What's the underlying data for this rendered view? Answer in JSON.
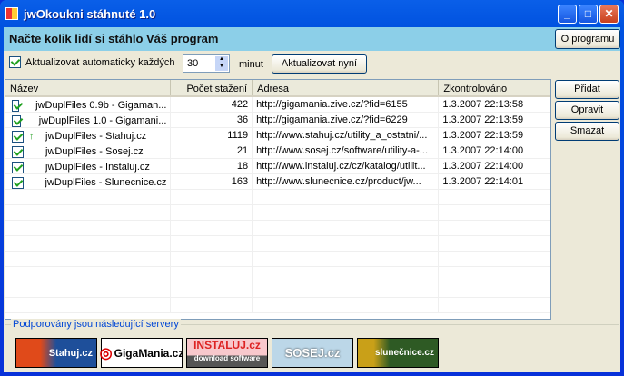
{
  "window": {
    "title": "jwOkoukni stáhnuté 1.0"
  },
  "header": {
    "text": "Načte kolik lidí si stáhlo Váš program",
    "about_button": "O programu"
  },
  "toolbar": {
    "auto_update_label": "Aktualizovat automaticky každých",
    "interval": "30",
    "unit": "minut",
    "update_now": "Aktualizovat nyní",
    "auto_update_checked": true
  },
  "table": {
    "columns": [
      "Název",
      "Počet stažení",
      "Adresa",
      "Zkontrolováno"
    ],
    "rows": [
      {
        "name": "jwDuplFiles 0.9b - Gigaman...",
        "count": "422",
        "url": "http://gigamania.zive.cz/?fid=6155",
        "checked": "1.3.2007 22:13:58",
        "arrow": ""
      },
      {
        "name": "jwDuplFiles 1.0 - Gigamani...",
        "count": "36",
        "url": "http://gigamania.zive.cz/?fid=6229",
        "checked": "1.3.2007 22:13:59",
        "arrow": ""
      },
      {
        "name": "jwDuplFiles - Stahuj.cz",
        "count": "1119",
        "url": "http://www.stahuj.cz/utility_a_ostatni/...",
        "checked": "1.3.2007 22:13:59",
        "arrow": "up"
      },
      {
        "name": "jwDuplFiles - Sosej.cz",
        "count": "21",
        "url": "http://www.sosej.cz/software/utility-a-...",
        "checked": "1.3.2007 22:14:00",
        "arrow": ""
      },
      {
        "name": "jwDuplFiles - Instaluj.cz",
        "count": "18",
        "url": "http://www.instaluj.cz/cz/katalog/utilit...",
        "checked": "1.3.2007 22:14:00",
        "arrow": ""
      },
      {
        "name": "jwDuplFiles - Slunecnice.cz",
        "count": "163",
        "url": "http://www.slunecnice.cz/product/jw...",
        "checked": "1.3.2007 22:14:01",
        "arrow": ""
      }
    ]
  },
  "side_buttons": [
    "Přidat",
    "Opravit",
    "Smazat"
  ],
  "servers": {
    "label": "Podporovány jsou následující servery",
    "logos": [
      "Stahuj.cz",
      "GigaMania.cz",
      "INSTALUJ.cz",
      "SOSEJ.cz",
      "slunečnice.cz"
    ],
    "instaluj_sub": "download software"
  }
}
